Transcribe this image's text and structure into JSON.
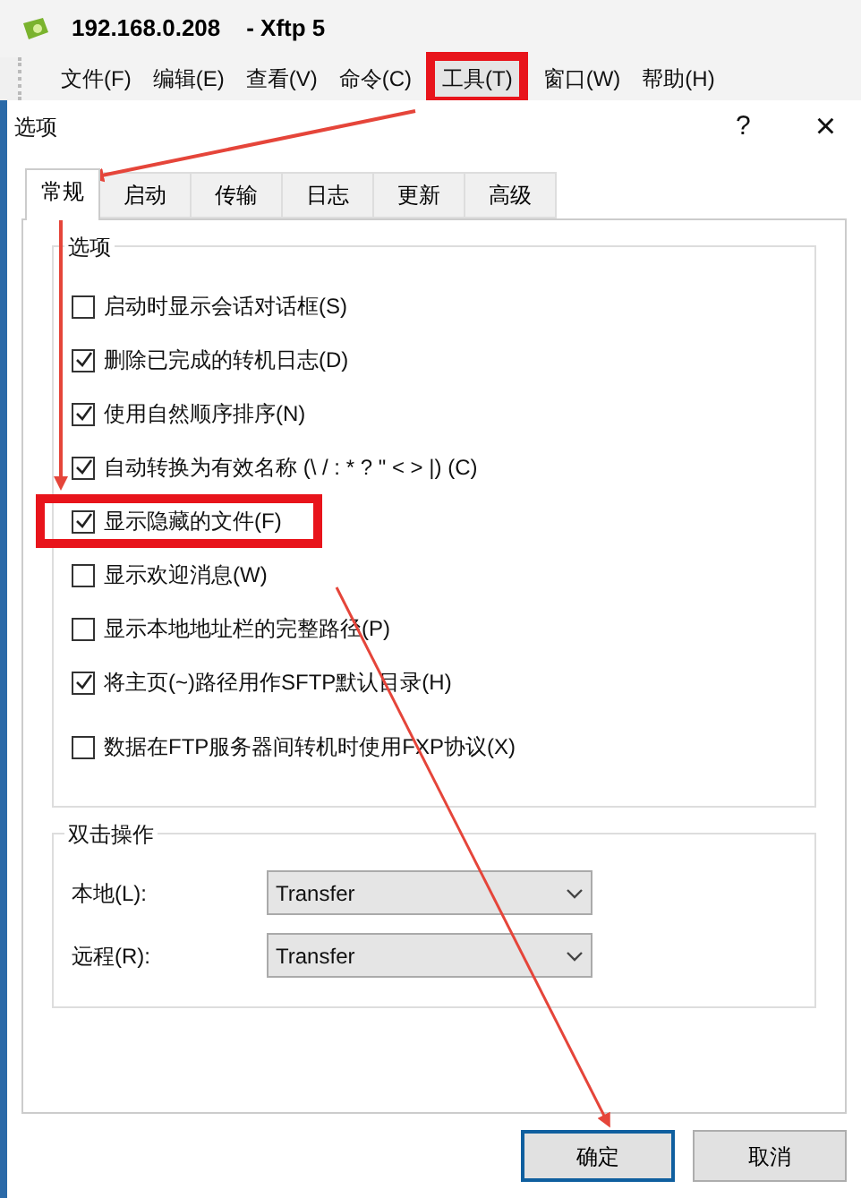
{
  "app_window": {
    "title": "192.168.0.208    - Xftp 5"
  },
  "menu_bar": [
    {
      "label": "文件(F)",
      "highlighted": false
    },
    {
      "label": "编辑(E)",
      "highlighted": false
    },
    {
      "label": "查看(V)",
      "highlighted": false
    },
    {
      "label": "命令(C)",
      "highlighted": false
    },
    {
      "label": "工具(T)",
      "highlighted": true
    },
    {
      "label": "窗口(W)",
      "highlighted": false
    },
    {
      "label": "帮助(H)",
      "highlighted": false
    }
  ],
  "dialog": {
    "title": "选项",
    "help": "?",
    "close": "×"
  },
  "tabs": [
    {
      "label": "常规",
      "selected": true
    },
    {
      "label": "启动",
      "selected": false
    },
    {
      "label": "传输",
      "selected": false
    },
    {
      "label": "日志",
      "selected": false
    },
    {
      "label": "更新",
      "selected": false
    },
    {
      "label": "高级",
      "selected": false
    }
  ],
  "options_group": {
    "title": "选项",
    "items": [
      {
        "label": "启动时显示会话对话框(S)",
        "checked": false,
        "highlighted": false
      },
      {
        "label": "删除已完成的转机日志(D)",
        "checked": true,
        "highlighted": false
      },
      {
        "label": "使用自然顺序排序(N)",
        "checked": true,
        "highlighted": false
      },
      {
        "label": "自动转换为有效名称 (\\ / : * ? \" < > |) (C)",
        "checked": true,
        "highlighted": false
      },
      {
        "label": "显示隐藏的文件(F)",
        "checked": true,
        "highlighted": true
      },
      {
        "label": "显示欢迎消息(W)",
        "checked": false,
        "highlighted": false
      },
      {
        "label": "显示本地地址栏的完整路径(P)",
        "checked": false,
        "highlighted": false
      },
      {
        "label": "将主页(~)路径用作SFTP默认目录(H)",
        "checked": true,
        "highlighted": false
      },
      {
        "label": "数据在FTP服务器间转机时使用FXP协议(X)",
        "checked": false,
        "highlighted": false
      }
    ]
  },
  "double_click_group": {
    "title": "双击操作",
    "rows": [
      {
        "label": "本地(L):",
        "value": "Transfer"
      },
      {
        "label": "远程(R):",
        "value": "Transfer"
      }
    ]
  },
  "buttons": [
    {
      "label": "确定",
      "default": true
    },
    {
      "label": "取消",
      "default": false
    }
  ]
}
